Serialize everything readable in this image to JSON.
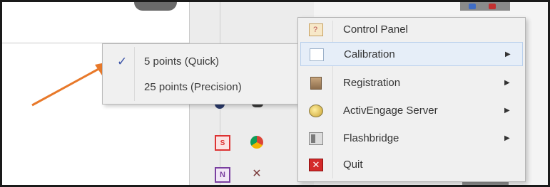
{
  "menu": {
    "items": [
      {
        "label": "Control Panel",
        "icon": "control-panel-icon",
        "has_submenu": false
      },
      {
        "label": "Calibration",
        "icon": "calibration-icon",
        "has_submenu": true
      },
      {
        "label": "Registration",
        "icon": "registration-icon",
        "has_submenu": true
      },
      {
        "label": "ActivEngage Server",
        "icon": "activengage-icon",
        "has_submenu": true
      },
      {
        "label": "Flashbridge",
        "icon": "flashbridge-icon",
        "has_submenu": true
      },
      {
        "label": "Quit",
        "icon": "quit-icon",
        "has_submenu": false
      }
    ],
    "hovered": "Calibration"
  },
  "submenu": {
    "items": [
      {
        "label": "5 points (Quick)",
        "checked": true
      },
      {
        "label": "25 points (Precision)",
        "checked": false
      }
    ]
  },
  "glyphs": {
    "check": "✓",
    "arrow": "▶",
    "quit": "✕",
    "onenote": "N"
  },
  "colors": {
    "annotation_arrow": "#e8792a",
    "hover_bg": "#e6eef8",
    "quit_red": "#d42a2a"
  }
}
